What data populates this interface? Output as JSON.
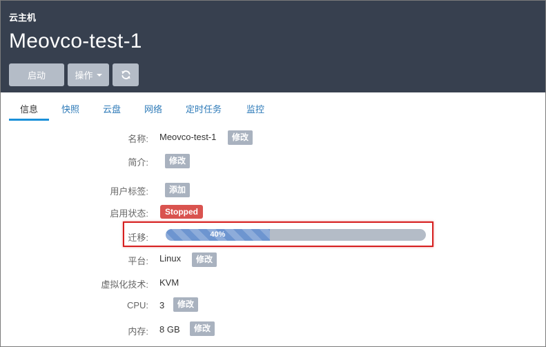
{
  "header": {
    "breadcrumb": "云主机",
    "title": "Meovco-test-1",
    "buttons": {
      "start_label": "启动",
      "ops_label": "操作",
      "refresh_icon": "refresh-icon"
    }
  },
  "tabs": [
    {
      "label": "信息",
      "active": true
    },
    {
      "label": "快照"
    },
    {
      "label": "云盘"
    },
    {
      "label": "网络"
    },
    {
      "label": "定时任务"
    },
    {
      "label": "监控"
    }
  ],
  "info": {
    "name": {
      "label": "名称:",
      "value": "Meovco-test-1",
      "action": "修改"
    },
    "description": {
      "label": "简介:",
      "action": "修改"
    },
    "user_tags": {
      "label": "用户标签:",
      "action": "添加"
    },
    "enable_state": {
      "label": "启用状态:",
      "value": "Stopped",
      "color": "#d9534f"
    },
    "migration": {
      "label": "迁移:",
      "progress_percent": 40,
      "progress_text": "40%"
    },
    "platform": {
      "label": "平台:",
      "value": "Linux",
      "action": "修改"
    },
    "virtualization": {
      "label": "虚拟化技术:",
      "value": "KVM"
    },
    "cpu": {
      "label": "CPU:",
      "value": "3",
      "action": "修改"
    },
    "memory": {
      "label": "内存:",
      "value": "8 GB",
      "action": "修改"
    }
  },
  "colors": {
    "header_bg": "#37404f",
    "accent": "#1a90d9",
    "link": "#2d7ab8",
    "highlight": "#d61f1f"
  }
}
